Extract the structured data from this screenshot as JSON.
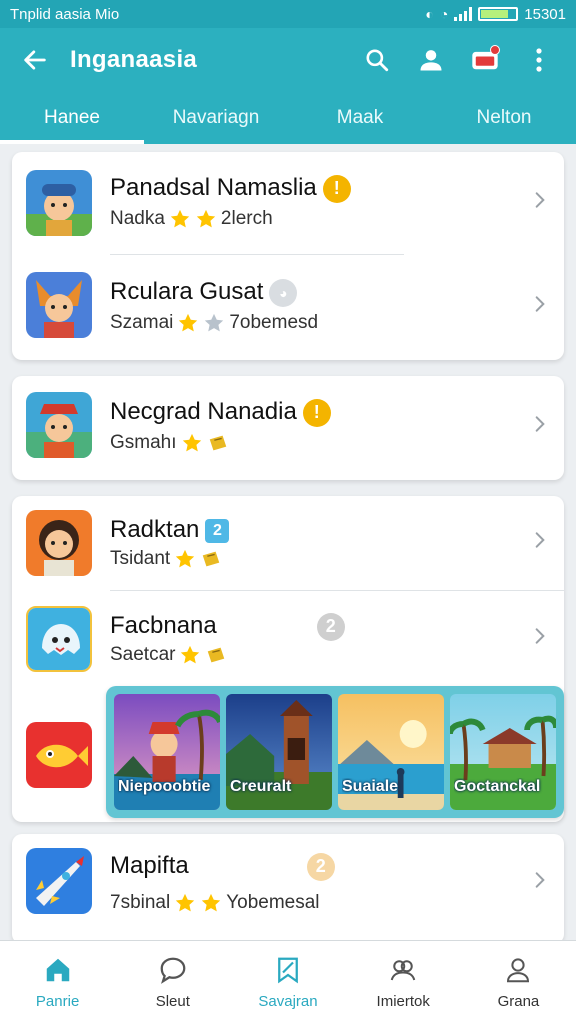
{
  "status_bar": {
    "left_text": "Tnplid aasia Mio",
    "time": "15301",
    "icons": [
      "signal-icon",
      "battery-icon"
    ]
  },
  "app_bar": {
    "title": "Inganaasia",
    "back_icon": "arrow-left-icon",
    "actions": [
      "search-icon",
      "account-icon",
      "notifications-icon",
      "more-vert-icon"
    ]
  },
  "tabs": [
    {
      "label": "Hanee",
      "active": true
    },
    {
      "label": "Navariagn",
      "active": false
    },
    {
      "label": "Maak",
      "active": false
    },
    {
      "label": "Nelton",
      "active": false
    }
  ],
  "list": {
    "card1": [
      {
        "title": "Panadsal Namaslia",
        "subtitle": "Nadka",
        "tail": "2lerch",
        "badge": "!",
        "stars": 2
      },
      {
        "title": "Rculara Gusat",
        "subtitle": "Szamai",
        "tail": "7obemesd",
        "badge": "",
        "stars": 2
      }
    ],
    "card2": [
      {
        "title": "Necgrad Nanadia",
        "subtitle": "Gsmahı",
        "tail": "",
        "badge": "!",
        "stars": 2
      }
    ],
    "card3": [
      {
        "title": "Radktan",
        "subtitle": "Tsidant",
        "tail": "",
        "badge": "2",
        "stars": 2
      },
      {
        "title": "Facbnana",
        "subtitle": "Saetcar",
        "tail": "",
        "badge": "2",
        "stars": 2
      }
    ],
    "card4": [
      {
        "title": "Mapifta",
        "subtitle": "7sbinal",
        "tail": "Yobemesal",
        "badge": "2",
        "stars": 2
      }
    ]
  },
  "featured": [
    {
      "label": "Niepooobtie"
    },
    {
      "label": "Creuralt"
    },
    {
      "label": "Suaiale"
    },
    {
      "label": "Goctanckal"
    }
  ],
  "bottom_nav": [
    {
      "label": "Panrie",
      "icon": "home-icon",
      "active": true
    },
    {
      "label": "Sleut",
      "icon": "chat-icon",
      "active": false
    },
    {
      "label": "Savajran",
      "icon": "bookmark-icon",
      "active": false
    },
    {
      "label": "Imiertok",
      "icon": "groups-icon",
      "active": false
    },
    {
      "label": "Grana",
      "icon": "profile-icon",
      "active": false
    }
  ],
  "colors": {
    "primary": "#2cb0bf",
    "status_bar": "#23a5b5",
    "badge_orange": "#f4b400",
    "badge_blue": "#4fb8e6",
    "badge_grey": "#c8c8c8",
    "badge_peach": "#f6d7a4",
    "star": "#ffc400",
    "active_nav": "#2aa9c0"
  }
}
